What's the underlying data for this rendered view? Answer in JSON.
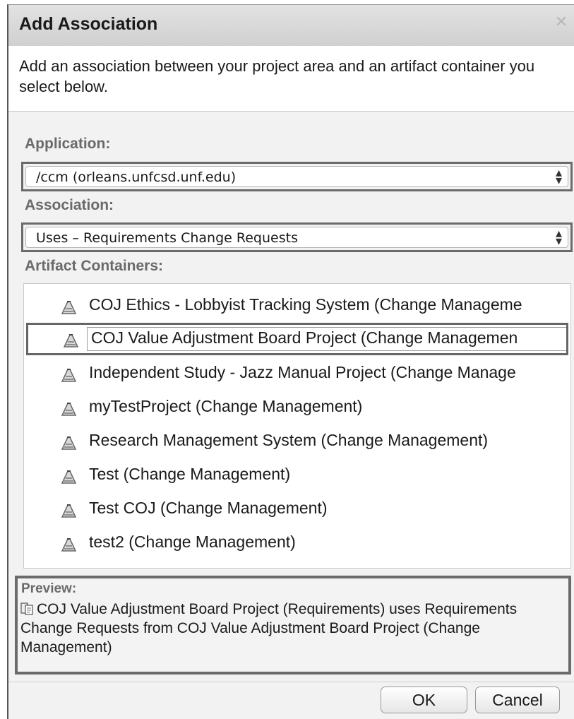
{
  "dialog": {
    "title": "Add Association",
    "description": "Add an association between your project area and an artifact container you select below."
  },
  "application": {
    "label": "Application:",
    "selected": "/ccm (orleans.unfcsd.unf.edu)"
  },
  "association": {
    "label": "Association:",
    "selected": "Uses – Requirements Change Requests"
  },
  "containers": {
    "label": "Artifact Containers:",
    "selected_index": 1,
    "items": [
      {
        "label": "COJ Ethics - Lobbyist Tracking System (Change Manageme"
      },
      {
        "label": "COJ Value Adjustment Board Project (Change Managemen"
      },
      {
        "label": "Independent Study - Jazz Manual Project (Change Manage"
      },
      {
        "label": "myTestProject (Change Management)"
      },
      {
        "label": "Research Management System (Change Management)"
      },
      {
        "label": "Test (Change Management)"
      },
      {
        "label": "Test COJ (Change Management)"
      },
      {
        "label": "test2 (Change Management)"
      }
    ],
    "item_icon": "project-area-icon"
  },
  "preview": {
    "label": "Preview:",
    "text": "COJ Value Adjustment Board Project (Requirements) uses Requirements Change Requests from COJ Value Adjustment Board Project (Change Management)",
    "icon": "requirements-project-icon"
  },
  "buttons": {
    "ok": "OK",
    "cancel": "Cancel"
  }
}
